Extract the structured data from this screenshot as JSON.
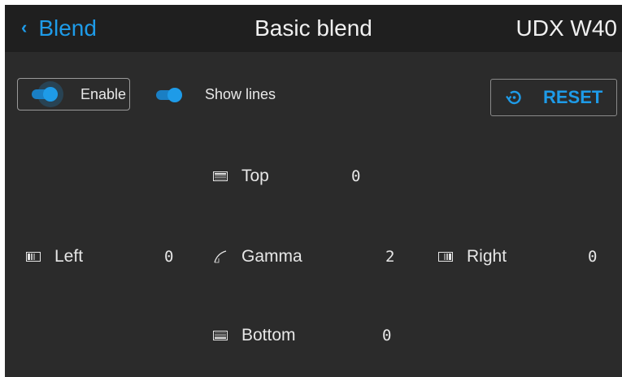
{
  "header": {
    "back_chevron": "‹",
    "back_label": "Blend",
    "title": "Basic blend",
    "device": "UDX W40"
  },
  "controls": {
    "enable_label": "Enable",
    "enable_on": true,
    "show_lines_label": "Show lines",
    "show_lines_on": true,
    "reset_label": "RESET"
  },
  "params": {
    "top": {
      "label": "Top",
      "value": "0",
      "icon": "blend-top-icon"
    },
    "left": {
      "label": "Left",
      "value": "0",
      "icon": "blend-left-icon"
    },
    "gamma": {
      "label": "Gamma",
      "value": "2",
      "icon": "gamma-curve-icon"
    },
    "right": {
      "label": "Right",
      "value": "0",
      "icon": "blend-right-icon"
    },
    "bottom": {
      "label": "Bottom",
      "value": "0",
      "icon": "blend-bottom-icon"
    }
  },
  "colors": {
    "accent": "#1e9be8",
    "background": "#2b2b2b",
    "header": "#1f1f1f",
    "text": "#e6e6e6"
  }
}
